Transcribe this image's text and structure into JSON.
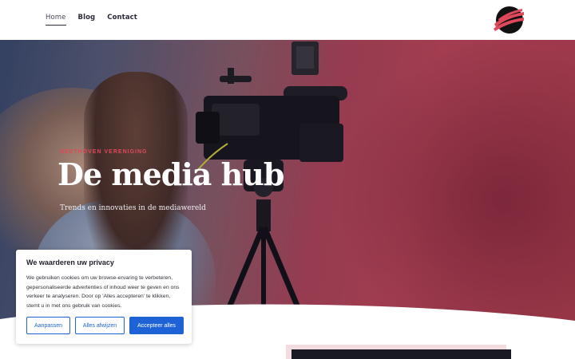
{
  "nav": {
    "items": [
      {
        "label": "Home",
        "active": true
      },
      {
        "label": "Blog",
        "active": false
      },
      {
        "label": "Contact",
        "active": false
      }
    ]
  },
  "brand": {
    "logo_icon": "stripe-ball-logo-icon",
    "logo_colors": [
      "#111111",
      "#e0495c"
    ]
  },
  "hero": {
    "eyebrow": "BEETHOVEN VERENIGING",
    "title": "De media hub",
    "tagline": "Trends en innovaties in de mediawereld",
    "accent_color": "#e0495c"
  },
  "cookie_banner": {
    "title": "We waarderen uw privacy",
    "body": "We gebruiken cookies om uw browse-ervaring te verbeteren, gepersonaliseerde advertenties of inhoud weer te geven en ons verkeer te analyseren. Door op 'Alles accepteren' te klikken, stemt u in met ons gebruik van cookies.",
    "buttons": {
      "customize": "Aanpassen",
      "reject": "Alles afwijzen",
      "accept": "Accepteer alles"
    },
    "button_color": "#1d63d6"
  }
}
